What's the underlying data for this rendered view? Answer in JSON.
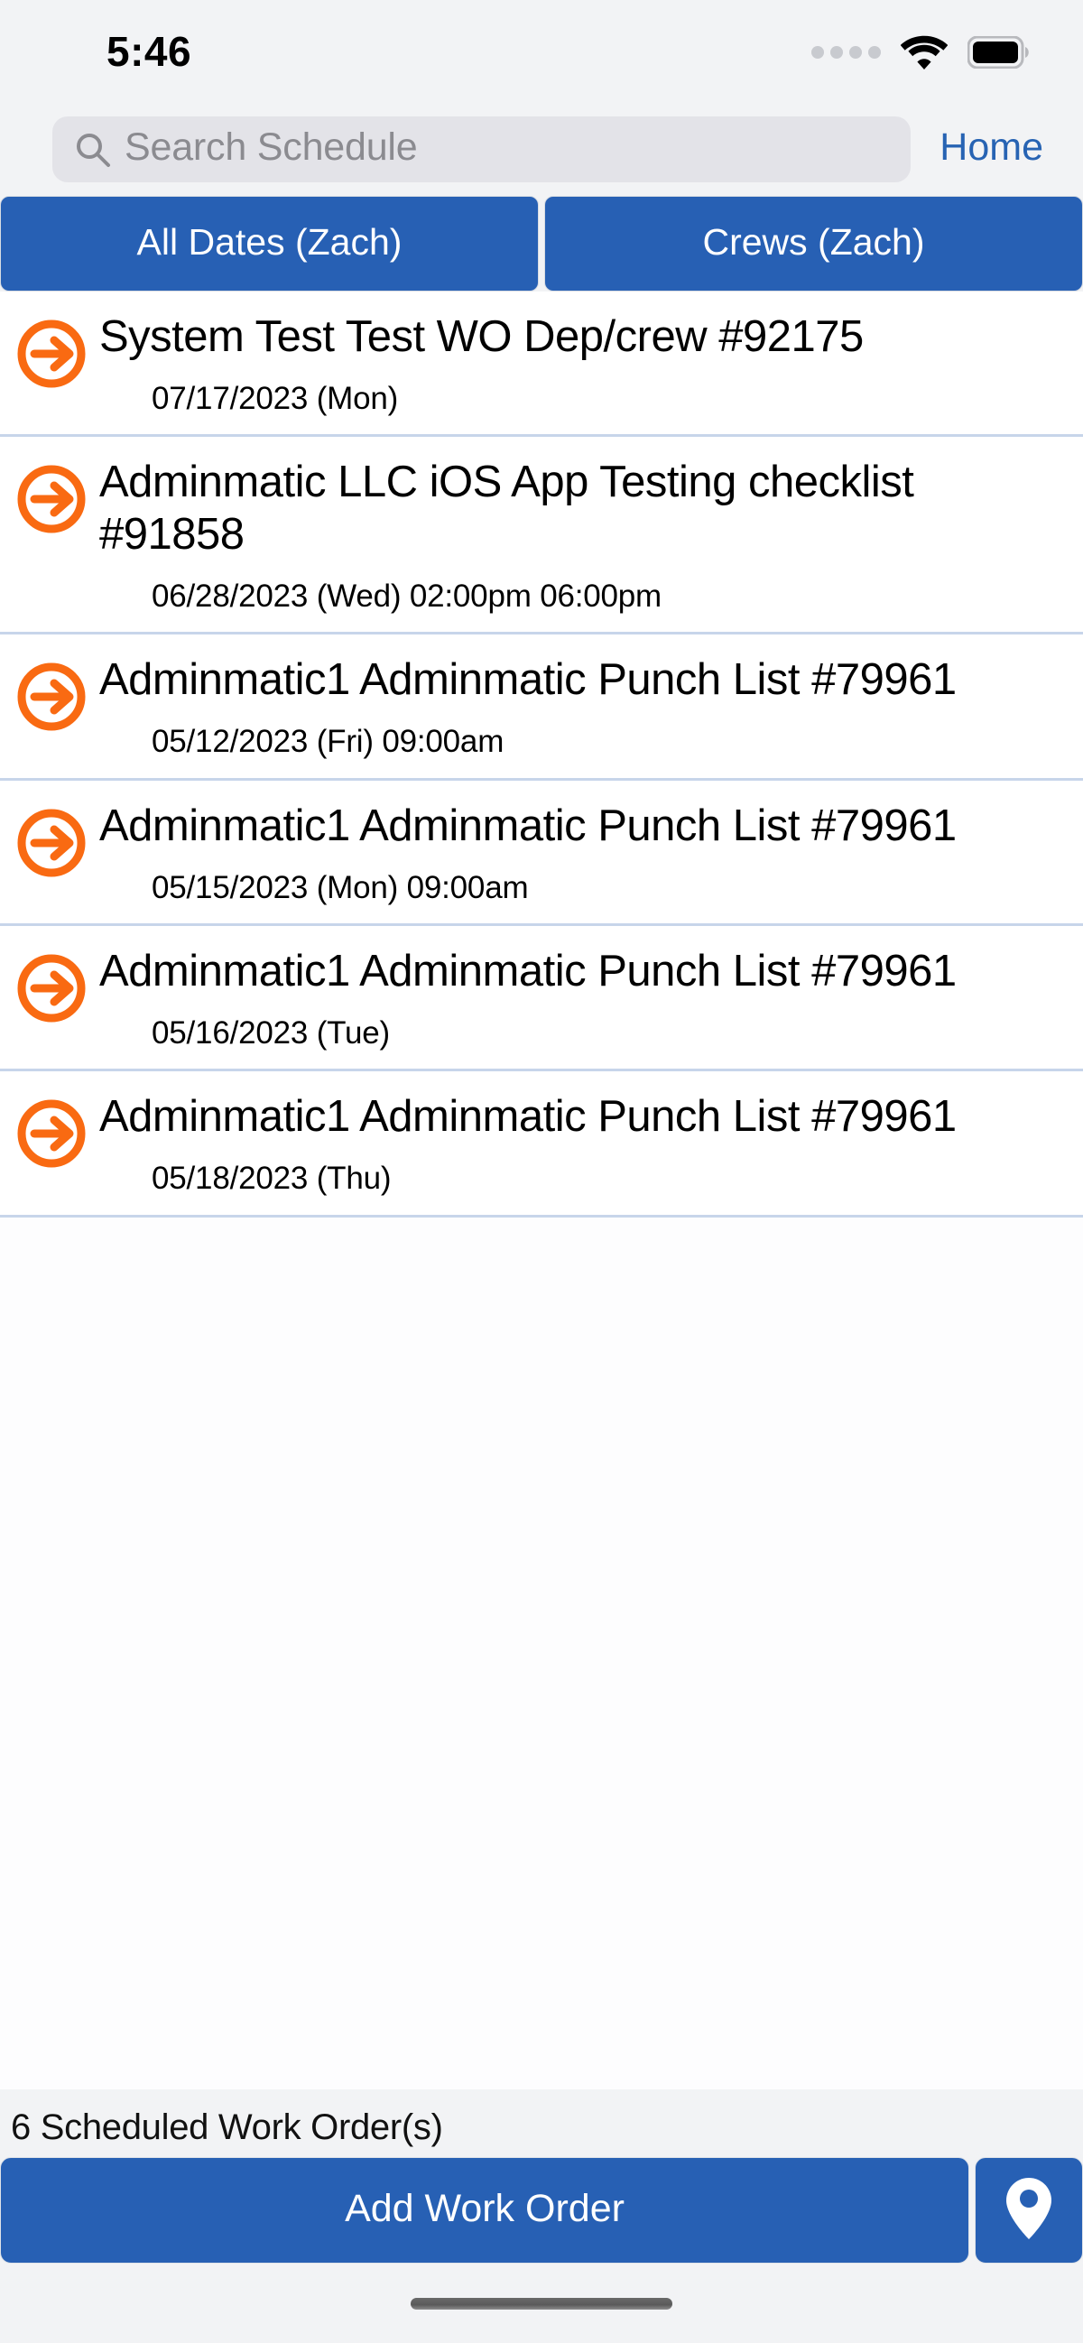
{
  "status_bar": {
    "time": "5:46",
    "cellular_icon": "signal-dots-icon",
    "wifi_icon": "wifi-icon",
    "battery_icon": "battery-full-icon"
  },
  "search": {
    "placeholder": "Search Schedule",
    "value": "",
    "icon": "search-icon"
  },
  "nav": {
    "home_label": "Home"
  },
  "segments": [
    {
      "label": "All Dates (Zach)"
    },
    {
      "label": "Crews (Zach)"
    }
  ],
  "list": {
    "row_icon": "arrow-right-circle-icon",
    "items": [
      {
        "title": "System Test Test WO Dep/crew #92175",
        "date": "07/17/2023 (Mon)"
      },
      {
        "title": "Adminmatic LLC iOS App Testing checklist  #91858",
        "date": "06/28/2023 (Wed) 02:00pm 06:00pm"
      },
      {
        "title": "Adminmatic1 Adminmatic Punch List #79961",
        "date": "05/12/2023 (Fri) 09:00am"
      },
      {
        "title": "Adminmatic1 Adminmatic Punch List #79961",
        "date": "05/15/2023 (Mon) 09:00am"
      },
      {
        "title": "Adminmatic1 Adminmatic Punch List #79961",
        "date": "05/16/2023 (Tue)"
      },
      {
        "title": "Adminmatic1 Adminmatic Punch List #79961",
        "date": "05/18/2023 (Thu)"
      }
    ]
  },
  "footer": {
    "count_label": "6 Scheduled Work Order(s)",
    "add_button_label": "Add Work Order",
    "map_button_icon": "map-pin-icon"
  },
  "colors": {
    "accent_blue": "#2760b4",
    "arrow_orange": "#f96a12",
    "link_blue": "#2763b3",
    "separator": "#c7d5ea",
    "screen_background": "#f2f3f5",
    "search_field": "#e3e3e8"
  }
}
